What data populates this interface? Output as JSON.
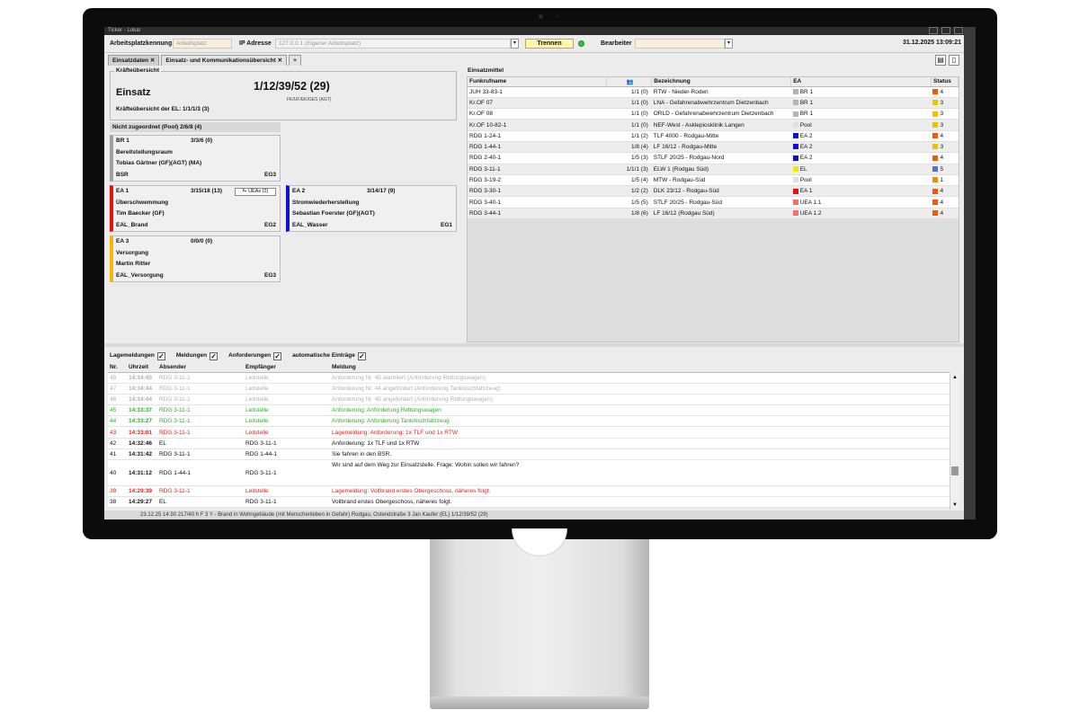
{
  "window": {
    "title": "Ticker - Lokal"
  },
  "topbar": {
    "arbeitsplatz_label": "Arbeitsplatzkennung",
    "arbeitsplatz_placeholder": "Arbeitsplatz",
    "ip_label": "IP Adresse",
    "ip_value": "127.0.0.1 (Eigener Arbeitsplatz)",
    "trennen_label": "Trennen",
    "bearbeiter_label": "Bearbeiter",
    "datetime": "31.12.2025 13:09:21"
  },
  "tabs": [
    {
      "label": "Einsatzdaten ✕"
    },
    {
      "label": "Einsatz- und Kommunikationsübersicht ✕"
    },
    {
      "label": "+"
    }
  ],
  "kraefte": {
    "title": "Kräfteübersicht",
    "einsatz_label": "Einsatz",
    "einsatz_value": "1/12/39/52 (29)",
    "einsatz_sub": "FK/UF/EK/GES (AGT)",
    "el_line": "Kräfteübersicht der EL: 1/1/1/3 (3)",
    "pool": "Nicht zugeordnet (Pool)  2/6/8 (4)"
  },
  "cards": {
    "br1": {
      "name": "BR 1",
      "count": "3/3/6 (0)",
      "line2": "Bereitstellungsraum",
      "line3": "Tobias Gärtner (GF)(AGT) (MA)",
      "line4": "BSR",
      "code": "EG3"
    },
    "ea1": {
      "name": "EA 1",
      "count": "3/15/18 (13)",
      "uea": "⮑ UEAs (2)",
      "line2": "Überschwemmung",
      "line3": "Tim Baecker (GF)",
      "line4": "EAL_Brand",
      "code": "EG2"
    },
    "ea2": {
      "name": "EA 2",
      "count": "3/14/17 (9)",
      "line2": "Stromwiederherstellung",
      "line3": "Sebastian Foerster (GF)(AGT)",
      "line4": "EAL_Wasser",
      "code": "EG1"
    },
    "ea3": {
      "name": "EA 3",
      "count": "0/0/0 (0)",
      "line2": "Versorgung",
      "line3": "Martin Ritter",
      "line4": "EAL_Versorgung",
      "code": "EG3"
    }
  },
  "einsatzmittel": {
    "title": "Einsatzmittel",
    "headers": {
      "funkrufname": "Funkrufname",
      "people_icon": "people-icon",
      "bezeichnung": "Bezeichnung",
      "ea": "EA",
      "status": "Status"
    },
    "rows": [
      {
        "funk": "JUH 33-83-1",
        "staerke": "1/1 (0)",
        "bez": "RTW - Nieder-Roden",
        "ea": "BR 1",
        "ea_color": "#b4b4b4",
        "status": "4",
        "status_color": "#f05a0a"
      },
      {
        "funk": "Kr.OF 07",
        "staerke": "1/1 (0)",
        "bez": "LNA - Gefahrenabwehrzentrum Dietzenbach",
        "ea": "BR 1",
        "ea_color": "#b4b4b4",
        "status": "3",
        "status_color": "#f2c200"
      },
      {
        "funk": "Kr.OF 08",
        "staerke": "1/1 (0)",
        "bez": "ORLD - Gefahrenabwehrzentrum Dietzenbach",
        "ea": "BR 1",
        "ea_color": "#b4b4b4",
        "status": "3",
        "status_color": "#f2c200"
      },
      {
        "funk": "Kr.OF 10-82-1",
        "staerke": "1/1 (0)",
        "bez": "NEF-West - Asklepiosklinik Langen",
        "ea": "Pool",
        "ea_color": "#e0e0e0",
        "status": "3",
        "status_color": "#f2c200"
      },
      {
        "funk": "RDG 1-24-1",
        "staerke": "1/1 (2)",
        "bez": "TLF 4000 - Rodgau-Mitte",
        "ea": "EA 2",
        "ea_color": "#1010d0",
        "status": "4",
        "status_color": "#f05a0a"
      },
      {
        "funk": "RDG 1-44-1",
        "staerke": "1/8 (4)",
        "bez": "LF 16/12 - Rodgau-Mitte",
        "ea": "EA 2",
        "ea_color": "#1010d0",
        "status": "3",
        "status_color": "#f2c200"
      },
      {
        "funk": "RDG 2-40-1",
        "staerke": "1/5 (3)",
        "bez": "STLF 20/25 - Rodgau-Nord",
        "ea": "EA 2",
        "ea_color": "#1010d0",
        "status": "4",
        "status_color": "#f05a0a"
      },
      {
        "funk": "RDG 3-11-1",
        "staerke": "1/1/1 (3)",
        "bez": "ELW 1 (Rodgau Süd)",
        "ea": "EL",
        "ea_color": "#f4e800",
        "status": "5",
        "status_color": "#5a6ae0"
      },
      {
        "funk": "RDG 3-19-2",
        "staerke": "1/5 (4)",
        "bez": "MTW - Rodgau-Süd",
        "ea": "Pool",
        "ea_color": "#e0e0e0",
        "status": "1",
        "status_color": "#f08a0a"
      },
      {
        "funk": "RDG 3-30-1",
        "staerke": "1/2 (2)",
        "bez": "DLK 23/12 - Rodgau-Süd",
        "ea": "EA 1",
        "ea_color": "#e81010",
        "status": "4",
        "status_color": "#f05a0a"
      },
      {
        "funk": "RDG 3-40-1",
        "staerke": "1/5 (5)",
        "bez": "STLF 20/25 - Rodgau-Süd",
        "ea": "UEA 1.1",
        "ea_color": "#f07070",
        "status": "4",
        "status_color": "#f05a0a"
      },
      {
        "funk": "RDG 3-44-1",
        "staerke": "1/8 (6)",
        "bez": "LF 16/12 (Rodgau Süd)",
        "ea": "UEA 1.2",
        "ea_color": "#f07070",
        "status": "4",
        "status_color": "#f05a0a"
      }
    ]
  },
  "log": {
    "filters": [
      "Lagemeldungen",
      "Meldungen",
      "Anforderungen",
      "automatische Einträge"
    ],
    "headers": {
      "nr": "Nr.",
      "uhrzeit": "Uhrzeit",
      "absender": "Absender",
      "empfaenger": "Empfänger",
      "meldung": "Meldung"
    },
    "rows": [
      {
        "nr": "48",
        "zeit": "14:34:45",
        "abs": "RDG 3-11-1",
        "emp": "Leitstelle",
        "msg": "Anforderung Nr. 45 alarmiert (Anforderung Rettungswagen)"
      },
      {
        "nr": "47",
        "zeit": "14:34:44",
        "abs": "RDG 3-11-1",
        "emp": "Leitstelle",
        "msg": "Anforderung Nr. 44 angefordert (Anforderung Tanklöschfahrzeug)"
      },
      {
        "nr": "46",
        "zeit": "14:34:44",
        "abs": "RDG 3-11-1",
        "emp": "Leitstelle",
        "msg": "Anforderung Nr. 45 angefordert (Anforderung Rettungswagen)"
      },
      {
        "nr": "45",
        "zeit": "14:33:37",
        "abs": "RDG 3-11-1",
        "emp": "Leitstelle",
        "msg": "Anforderung: Anforderung Rettungswagen"
      },
      {
        "nr": "44",
        "zeit": "14:33:27",
        "abs": "RDG 3-11-1",
        "emp": "Leitstelle",
        "msg": "Anforderung: Anforderung Tanklöschfahrzeug"
      },
      {
        "nr": "43",
        "zeit": "14:33:01",
        "abs": "RDG 3-11-1",
        "emp": "Leitstelle",
        "msg": "Lagemeldung: Anforderung: 1x TLF und 1x RTW"
      },
      {
        "nr": "42",
        "zeit": "14:32:46",
        "abs": "EL",
        "emp": "RDG 3-11-1",
        "msg": "Anforderung: 1x TLF und 1x RTW"
      },
      {
        "nr": "41",
        "zeit": "14:31:42",
        "abs": "RDG 3-11-1",
        "emp": "RDG 1-44-1",
        "msg": "Sie fahren in den BSR."
      },
      {
        "nr": "40",
        "zeit": "14:31:12",
        "abs": "RDG 1-44-1",
        "emp": "RDG 3-11-1",
        "msg": "Wir sind auf dem Weg zur Einsatzstelle. Frage: Wohin sollen wir fahren?"
      },
      {
        "nr": "39",
        "zeit": "14:29:39",
        "abs": "RDG 3-11-1",
        "emp": "Leitstelle",
        "msg": "Lagemeldung: Vollbrand erstes Obergeschoss, näheres folgt."
      },
      {
        "nr": "38",
        "zeit": "14:29:27",
        "abs": "EL",
        "emp": "RDG 3-11-1",
        "msg": "Vollbrand erstes Obergeschoss, näheres folgt."
      }
    ],
    "statusline": "23.12.25 14:30    217/40 h       F 3 Y - Brand in Wohngebäude (mit Menschenleben in Gefahr)              Rodgau, Ostendstraße 3         Jan Kaufer (EL)          1/12/39/52 (29)"
  },
  "colors": {
    "br1": "#a0a0a0",
    "ea1": "#e81010",
    "ea2": "#1010d0",
    "ea3": "#f2b800"
  }
}
